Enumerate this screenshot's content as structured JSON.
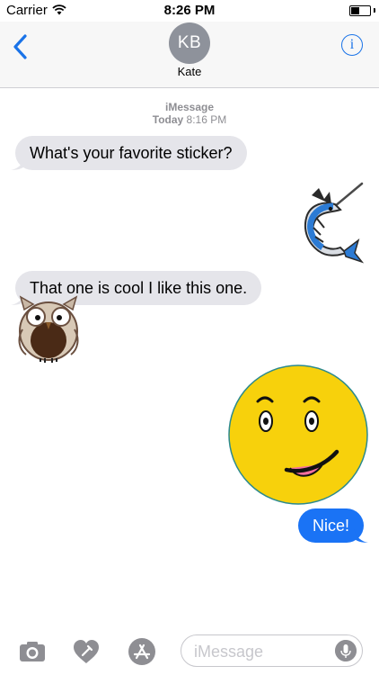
{
  "status_bar": {
    "carrier": "Carrier",
    "time": "8:26 PM"
  },
  "header": {
    "avatar_initials": "KB",
    "contact_name": "Kate",
    "info_glyph": "i"
  },
  "conversation": {
    "service": "iMessage",
    "timestamp_day": "Today",
    "timestamp_time": "8:16 PM",
    "messages": [
      {
        "direction": "incoming",
        "text": "What's your favorite sticker?"
      },
      {
        "direction": "outgoing",
        "sticker": "marlin-sticker"
      },
      {
        "direction": "incoming",
        "text": "That one is cool I like this one."
      },
      {
        "direction": "incoming",
        "sticker": "owl-sticker"
      },
      {
        "direction": "outgoing",
        "sticker": "smiley-tongue-sticker"
      },
      {
        "direction": "outgoing",
        "text": "Nice!"
      }
    ]
  },
  "input_bar": {
    "placeholder": "iMessage",
    "tools": [
      "camera-icon",
      "digital-touch-icon",
      "app-store-icon"
    ],
    "mic": "microphone-icon"
  },
  "colors": {
    "accent": "#1a73e8",
    "outgoing_bubble": "#1a73f5",
    "incoming_bubble": "#e5e5ea",
    "smiley": "#f7d10c"
  }
}
